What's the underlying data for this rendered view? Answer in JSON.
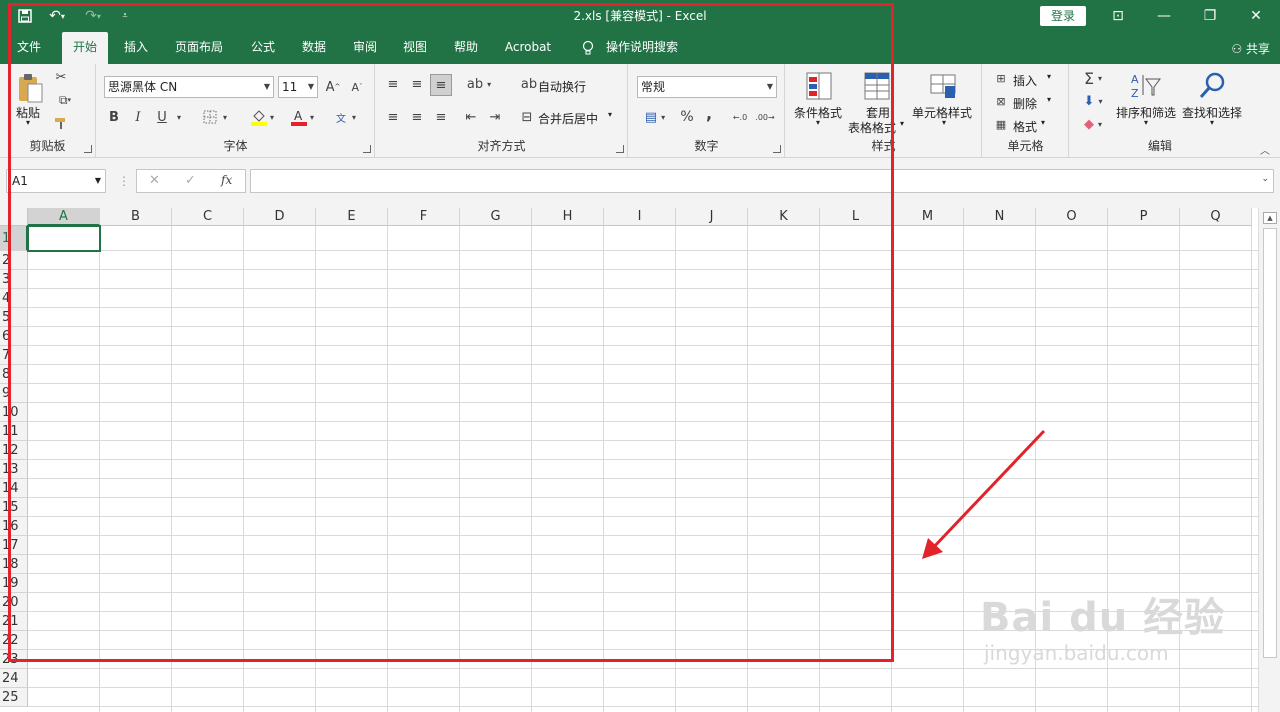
{
  "titlebar": {
    "title": "2.xls  [兼容模式]  -  Excel",
    "login": "登录"
  },
  "tabs": [
    "文件",
    "开始",
    "插入",
    "页面布局",
    "公式",
    "数据",
    "审阅",
    "视图",
    "帮助",
    "Acrobat",
    "操作说明搜索"
  ],
  "share": "共享",
  "ribbon": {
    "clipboard": {
      "label": "剪贴板",
      "paste": "粘贴"
    },
    "font": {
      "label": "字体",
      "name": "思源黑体 CN",
      "size": "11",
      "bold": "B",
      "italic": "I",
      "underline": "U"
    },
    "align": {
      "label": "对齐方式",
      "wrap": "自动换行",
      "merge": "合并后居中"
    },
    "number": {
      "label": "数字",
      "format": "常规",
      "percent": "%",
      "comma": ","
    },
    "styles": {
      "label": "样式",
      "cond": "条件格式",
      "table1": "套用",
      "table2": "表格格式",
      "cell": "单元格样式"
    },
    "cells": {
      "label": "单元格",
      "insert": "插入",
      "delete": "删除",
      "format": "格式"
    },
    "editing": {
      "label": "编辑",
      "sort": "排序和筛选",
      "find": "查找和选择"
    }
  },
  "formula": {
    "namebox": "A1",
    "fx": "fx"
  },
  "columns": [
    "A",
    "B",
    "C",
    "D",
    "E",
    "F",
    "G",
    "H",
    "I",
    "J",
    "K",
    "L",
    "M",
    "N",
    "O",
    "P",
    "Q"
  ],
  "rows": [
    "1",
    "2",
    "3",
    "4",
    "5",
    "6",
    "7",
    "8",
    "9",
    "10",
    "11",
    "12",
    "13",
    "14",
    "15",
    "16",
    "17",
    "18",
    "19",
    "20",
    "21",
    "22",
    "23",
    "24",
    "25"
  ],
  "watermark": {
    "brand": "Bai du 经验",
    "url": "jingyan.baidu.com"
  },
  "colors": {
    "excel_green": "#217346",
    "annotation_red": "#e2232a"
  }
}
